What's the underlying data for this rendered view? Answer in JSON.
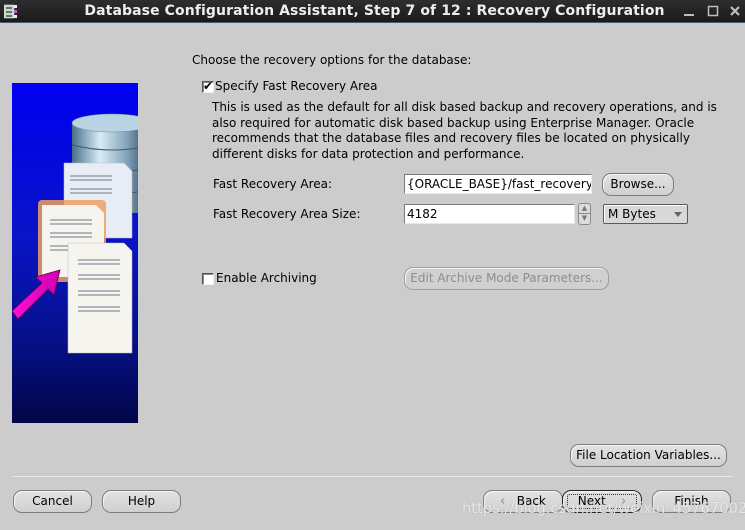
{
  "window": {
    "title": "Database Configuration Assistant, Step 7 of 12 : Recovery Configuration",
    "controls": {
      "minimize": "_",
      "maximize": "□",
      "close": "×"
    }
  },
  "content": {
    "intro": "Choose the recovery options for the database:",
    "fast_recovery": {
      "checkbox_label": "Specify Fast Recovery Area",
      "checked": true,
      "description": "This is used as the default for all disk based backup and recovery operations, and is also required for automatic disk based backup using Enterprise Manager. Oracle recommends that the database files and recovery files be located on physically different disks for data protection and performance.",
      "area_label": "Fast Recovery Area:",
      "area_value": "{ORACLE_BASE}/fast_recovery_a",
      "browse_label": "Browse...",
      "size_label": "Fast Recovery Area Size:",
      "size_value": "4182",
      "size_unit": "M Bytes"
    },
    "archiving": {
      "checkbox_label": "Enable Archiving",
      "checked": false,
      "edit_button_label": "Edit Archive Mode Parameters..."
    },
    "file_location_variables_label": "File Location Variables..."
  },
  "footer": {
    "cancel": "Cancel",
    "help": "Help",
    "back": "Back",
    "next": "Next",
    "finish": "Finish",
    "back_icon": "‹",
    "next_icon": "›"
  },
  "watermark": "https://blog.csdn.net/weixin_45767002",
  "colors": {
    "background": "#cccccc",
    "titlebar": "#1f1f1f",
    "side_image_top": "#0000f0",
    "side_image_bottom": "#020646",
    "arrow_accent": "#ff00cc"
  }
}
